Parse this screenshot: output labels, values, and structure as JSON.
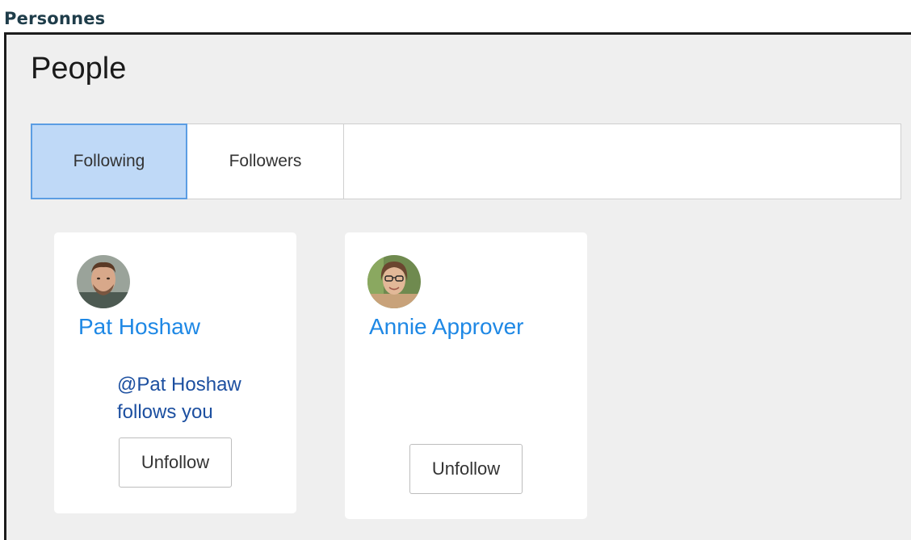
{
  "section_heading": "Personnes",
  "page": {
    "title": "People"
  },
  "tabs": [
    {
      "label": "Following",
      "selected": true
    },
    {
      "label": "Followers",
      "selected": false
    }
  ],
  "people": [
    {
      "name": "Pat Hoshaw",
      "follows_you_note": "@Pat Hoshaw follows you",
      "action_label": "Unfollow",
      "avatar_icon": "user-avatar-icon"
    },
    {
      "name": "Annie Approver",
      "action_label": "Unfollow",
      "avatar_icon": "user-avatar-icon"
    }
  ],
  "colors": {
    "accent_link": "#1e88e5",
    "selected_tab_bg": "#bfd9f7",
    "selected_tab_border": "#5b9de3",
    "heading": "#1f3d4a",
    "panel_bg": "#efefef"
  }
}
